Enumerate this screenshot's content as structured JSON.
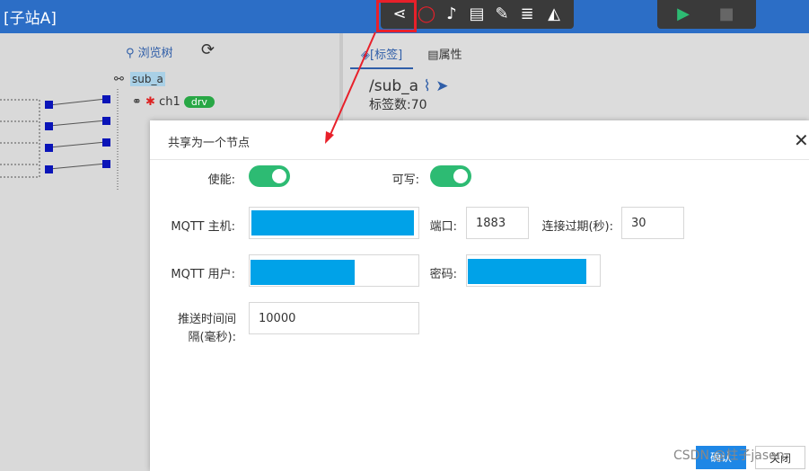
{
  "window": {
    "title": "[子站A]"
  },
  "toolbar": {
    "icons": [
      "share-icon",
      "power-icon",
      "bell-icon",
      "book-icon",
      "edit-icon",
      "database-icon",
      "chart-icon"
    ],
    "run": [
      "play-icon",
      "stop-icon"
    ]
  },
  "left_pane": {
    "browse_label": "浏览树",
    "root_label": "sub_a",
    "channel_name": "ch1",
    "channel_badge": "drv"
  },
  "right_pane": {
    "tabs": [
      "[标签]",
      "属性"
    ],
    "path": "/sub_a",
    "tag_count": "标签数:70"
  },
  "dialog": {
    "title": "共享为一个节点",
    "enable_label": "使能:",
    "writable_label": "可写:",
    "enable_on": true,
    "writable_on": true,
    "mqtt_host_label": "MQTT 主机:",
    "port_label": "端口:",
    "port_value": "1883",
    "timeout_label": "连接过期(秒):",
    "timeout_value": "30",
    "mqtt_user_label": "MQTT 用户:",
    "password_label": "密码:",
    "interval_label": "推送时间间隔(毫秒):",
    "interval_value": "10000",
    "ok_label": "确认",
    "close_label": "关闭"
  },
  "watermark": "CSDN @柱子jason",
  "colors": {
    "accent": "#2c6ec6",
    "toggle": "#2dbb73",
    "redact": "#00a2e8",
    "highlight": "#e8202a"
  }
}
